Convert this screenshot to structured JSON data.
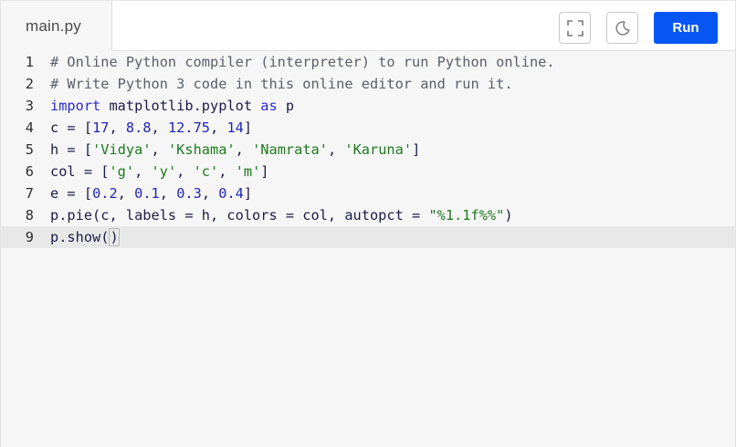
{
  "tab": {
    "label": "main.py"
  },
  "toolbar": {
    "run_label": "Run",
    "fullscreen_icon": "fullscreen-icon",
    "theme_icon": "moon-icon"
  },
  "editor": {
    "lines": [
      {
        "n": "1",
        "text": "# Online Python compiler (interpreter) to run Python online."
      },
      {
        "n": "2",
        "text": "# Write Python 3 code in this online editor and run it."
      },
      {
        "n": "3",
        "text": "import matplotlib.pyplot as p"
      },
      {
        "n": "4",
        "text": "c = [17, 8.8, 12.75, 14]"
      },
      {
        "n": "5",
        "text": "h = ['Vidya', 'Kshama', 'Namrata', 'Karuna']"
      },
      {
        "n": "6",
        "text": "col = ['g', 'y', 'c', 'm']"
      },
      {
        "n": "7",
        "text": "e = [0.2, 0.1, 0.3, 0.4]"
      },
      {
        "n": "8",
        "text": "p.pie(c, labels = h, colors = col, autopct = \"%1.1f%%\")"
      },
      {
        "n": "9",
        "text": "p.show()"
      }
    ],
    "active_line": "9"
  },
  "colors": {
    "accent": "#0556f3",
    "background": "#f6f6f6"
  }
}
